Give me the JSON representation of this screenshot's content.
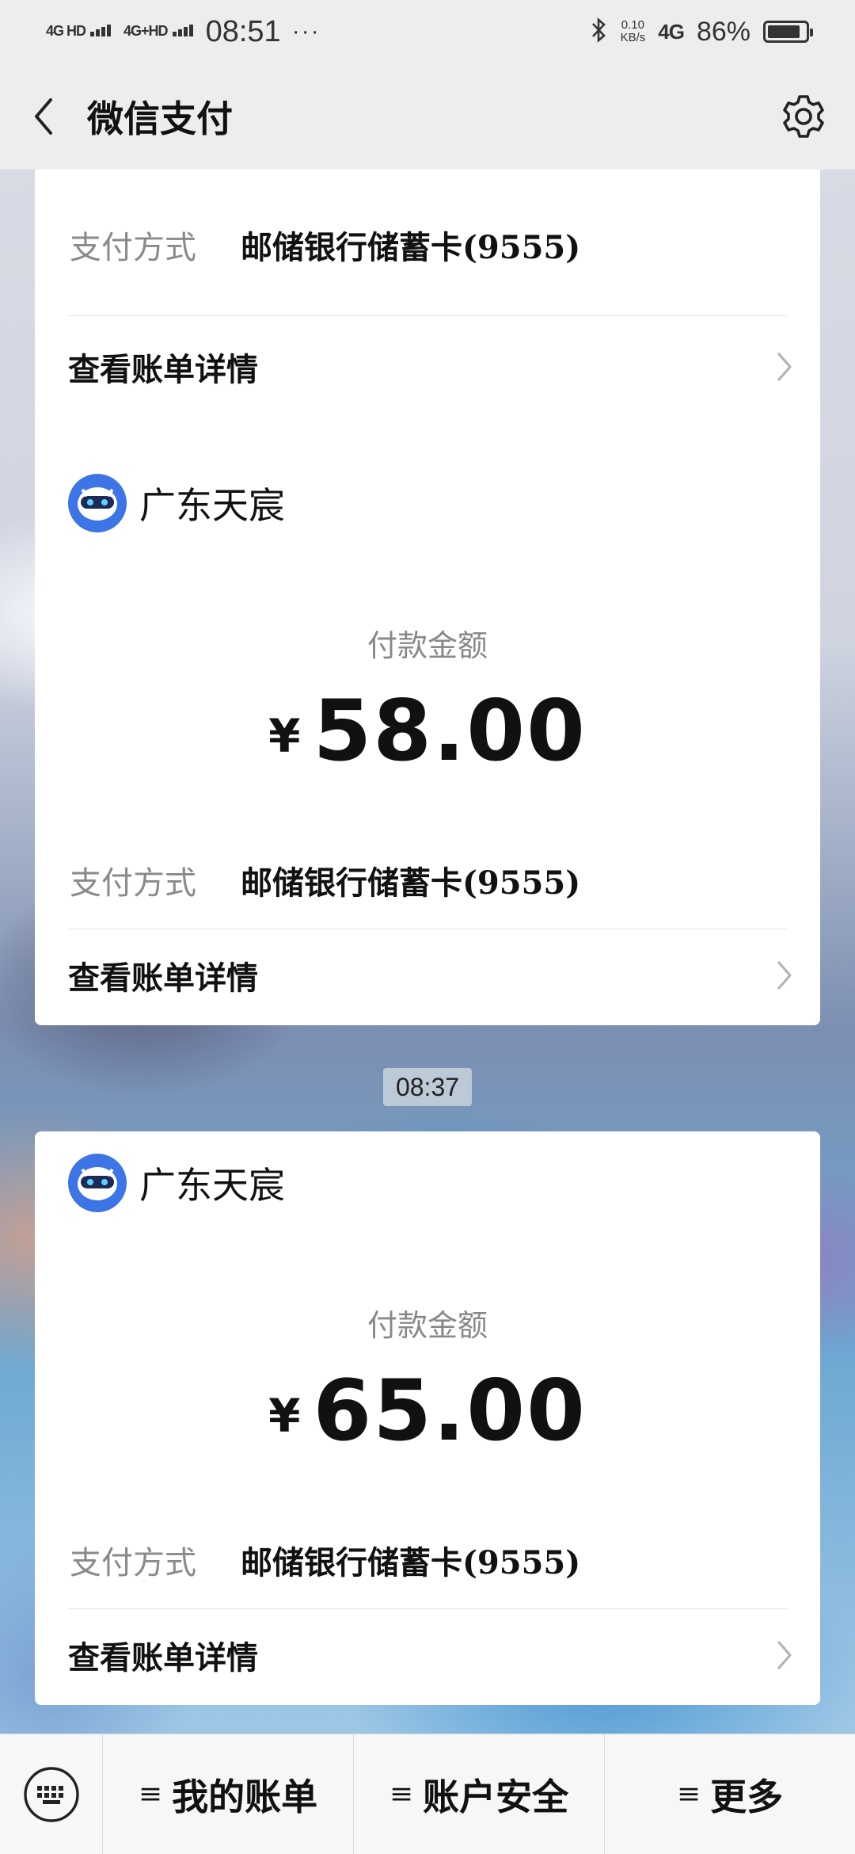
{
  "status_bar": {
    "signal1": "4G HD",
    "signal2": "4G+HD",
    "time": "08:51",
    "dots": "···",
    "net_speed_value": "0.10",
    "net_speed_unit": "KB/s",
    "net_type": "4G",
    "battery_percent": "86%",
    "battery_level": 0.86
  },
  "nav": {
    "title": "微信支付"
  },
  "cards": [
    {
      "pay_method_label": "支付方式",
      "pay_method_value": "邮储银行储蓄卡(9555)",
      "detail_label": "查看账单详情"
    },
    {
      "merchant": "广东天宸",
      "amount_label": "付款金额",
      "currency": "¥",
      "amount": "58.00",
      "pay_method_label": "支付方式",
      "pay_method_value": "邮储银行储蓄卡(9555)",
      "detail_label": "查看账单详情"
    },
    {
      "merchant": "广东天宸",
      "amount_label": "付款金额",
      "currency": "¥",
      "amount": "65.00",
      "pay_method_label": "支付方式",
      "pay_method_value": "邮储银行储蓄卡(9555)",
      "detail_label": "查看账单详情"
    }
  ],
  "time_separator": "08:37",
  "bottom_bar": {
    "tabs": [
      {
        "label": "我的账单"
      },
      {
        "label": "账户安全"
      },
      {
        "label": "更多"
      }
    ],
    "menu_glyph": "≡"
  }
}
